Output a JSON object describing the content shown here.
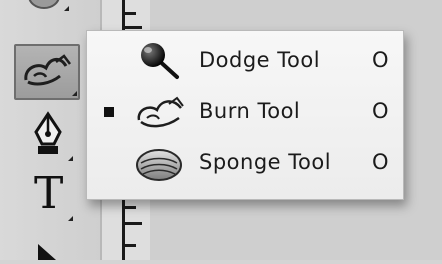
{
  "flyout": {
    "items": [
      {
        "label": "Dodge Tool",
        "shortcut": "O",
        "icon": "dodge-icon",
        "active": false
      },
      {
        "label": "Burn Tool",
        "shortcut": "O",
        "icon": "burn-icon",
        "active": true
      },
      {
        "label": "Sponge Tool",
        "shortcut": "O",
        "icon": "sponge-icon",
        "active": false
      }
    ]
  },
  "toolbar": {
    "type_tool_glyph": "T",
    "tools": [
      "blur-icon",
      "burn-icon",
      "pen-icon",
      "type-icon",
      "path-selection-icon"
    ]
  },
  "colors": {
    "menu_background": "#f2f2f2",
    "toolbar_background": "#d4d4d4",
    "selected_tool_background": "#a8a8a8"
  }
}
